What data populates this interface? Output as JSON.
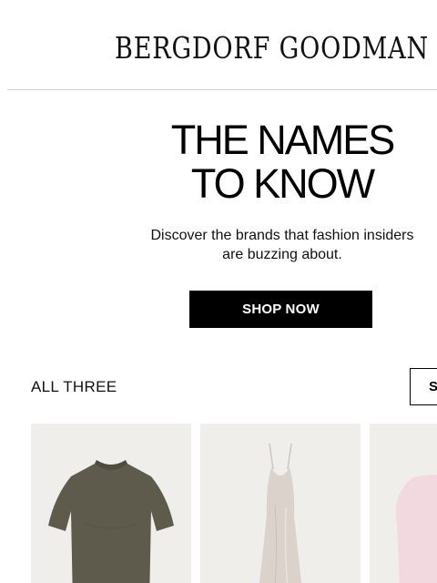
{
  "header": {
    "logo_text": "BERGDORF GOODMAN"
  },
  "hero": {
    "title_line1": "THE NAMES",
    "title_line2": "TO KNOW",
    "subtitle_line1": "Discover the brands that fashion insiders",
    "subtitle_line2": "are buzzing about.",
    "cta_label": "SHOP NOW"
  },
  "section": {
    "title": "ALL THREE",
    "shop_button_label": "S"
  },
  "products": [
    {
      "icon": "olive-tshirt-image",
      "color": "#5e5a4c"
    },
    {
      "icon": "satin-slip-dress-image",
      "color": "#dcd2cc"
    },
    {
      "icon": "pink-sweater-image",
      "color": "#f2d9e0"
    }
  ],
  "colors": {
    "text": "#000000",
    "button_bg": "#000000",
    "button_text": "#ffffff",
    "card_bg": "#efeeea",
    "divider": "#cfcfcf"
  }
}
